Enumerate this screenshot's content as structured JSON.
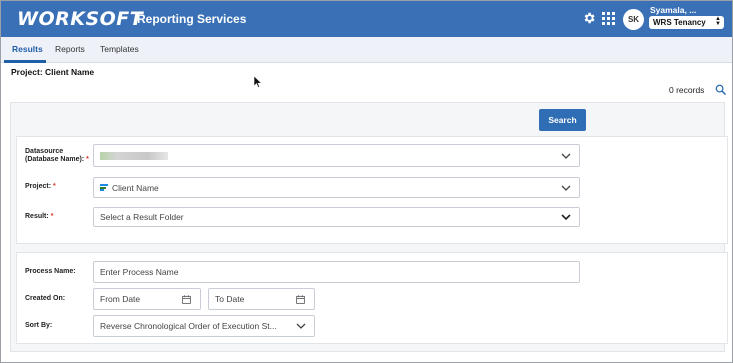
{
  "header": {
    "logo": "WORKSOFT",
    "app_name": "Reporting Services",
    "avatar_initials": "SK",
    "username": "Syamala, ...",
    "tenancy": "WRS Tenancy",
    "icons": [
      "gear-icon",
      "app-grid-icon"
    ],
    "colors": {
      "brand": "#3a70b6",
      "accent": "#1f5fa8"
    }
  },
  "tabs": [
    {
      "label": "Results",
      "active": true
    },
    {
      "label": "Reports",
      "active": false
    },
    {
      "label": "Templates",
      "active": false
    }
  ],
  "project_title": "Project: Client Name",
  "records": "0 records",
  "search_button": "Search",
  "form": {
    "datasource": {
      "label_line1": "Datasource",
      "label_line2": "(Database Name):",
      "required": "*",
      "value": ""
    },
    "project": {
      "label": "Project:",
      "required": "*",
      "value": "Client Name"
    },
    "result": {
      "label": "Result:",
      "required": "*",
      "value": "Select a Result Folder"
    },
    "process_name": {
      "label": "Process Name:",
      "placeholder": "Enter Process Name"
    },
    "created_on": {
      "label": "Created On:",
      "from_placeholder": "From Date",
      "to_placeholder": "To Date"
    },
    "sort_by": {
      "label": "Sort By:",
      "value": "Reverse Chronological Order of Execution St..."
    }
  }
}
